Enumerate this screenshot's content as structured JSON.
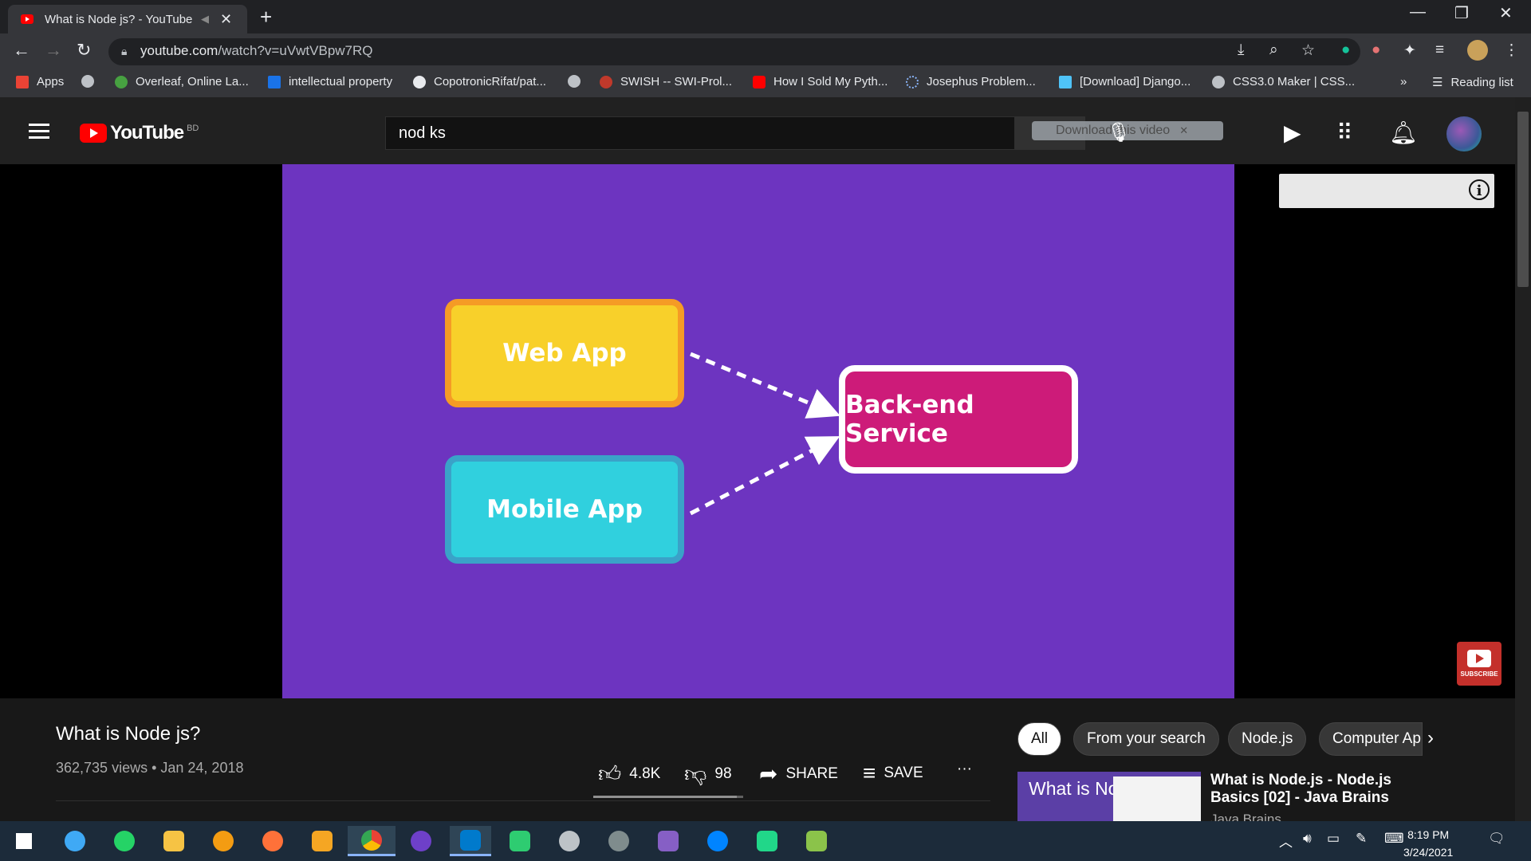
{
  "browser": {
    "tab_title": "What is Node js? - YouTube",
    "url_host": "youtube.com",
    "url_path": "/watch?v=uVwtVBpw7RQ",
    "new_tab": "+",
    "bookmarks": [
      {
        "label": "Apps",
        "color": "#ea4335"
      },
      {
        "label": "",
        "color": "#bdc1c6"
      },
      {
        "label": "Overleaf, Online La...",
        "color": "#47a141"
      },
      {
        "label": "intellectual property",
        "color": "#1a73e8"
      },
      {
        "label": "CopotronicRifat/pat...",
        "color": "#e8eaed"
      },
      {
        "label": "",
        "color": "#bdc1c6"
      },
      {
        "label": "SWISH -- SWI-Prol...",
        "color": "#c0392b"
      },
      {
        "label": "How I Sold My Pyth...",
        "color": "#ff0000"
      },
      {
        "label": "Josephus Problem...",
        "color": "#8ab4f8"
      },
      {
        "label": "[Download] Django...",
        "color": "#4fc3f7"
      },
      {
        "label": "CSS3.0 Maker | CSS...",
        "color": "#bdc1c6"
      }
    ],
    "more_bookmarks": "»",
    "reading_list": "Reading list"
  },
  "youtube": {
    "logo_text": "YouTube",
    "country_code": "BD",
    "search_value": "nod ks",
    "download_bar": "Download this video",
    "video": {
      "boxes": {
        "web_app": "Web App",
        "mobile_app": "Mobile App",
        "backend": "Back-end Service"
      },
      "subscribe_watermark": "SUBSCRIBE"
    },
    "title": "What is Node js?",
    "views": "362,735 views",
    "date": "Jan 24, 2018",
    "likes": "4.8K",
    "dislikes": "98",
    "share": "SHARE",
    "save": "SAVE",
    "more": "···",
    "chips": [
      "All",
      "From your search",
      "Node.js",
      "Computer Ap"
    ],
    "related": {
      "thumb_text": "What is Node.js?",
      "title": "What is Node.js - Node.js Basics [02] - Java Brains",
      "channel": "Java Brains"
    }
  },
  "taskbar": {
    "time": "8:19 PM",
    "date": "3/24/2021"
  },
  "colors": {
    "video_bg": "#6d34c0",
    "web_app_fill": "#f8d02a",
    "mobile_app_fill": "#30d0de",
    "backend_fill": "#cd1b79"
  }
}
